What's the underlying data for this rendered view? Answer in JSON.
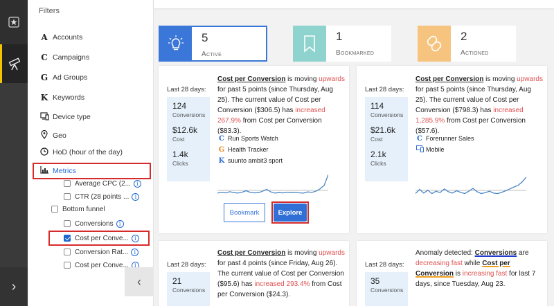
{
  "filters": {
    "title": "Filters",
    "items": [
      {
        "icon": "A",
        "label": "Accounts"
      },
      {
        "icon": "C",
        "label": "Campaigns"
      },
      {
        "icon": "G",
        "label": "Ad Groups"
      },
      {
        "icon": "K",
        "label": "Keywords"
      },
      {
        "icon": "device-icon",
        "label": "Device type"
      },
      {
        "icon": "location-pin-icon",
        "label": "Geo"
      },
      {
        "icon": "clock-icon",
        "label": "HoD (hour of the day)"
      },
      {
        "icon": "bar-chart-icon",
        "label": "Metrics"
      }
    ],
    "sub": {
      "avg_cpc": "Average CPC (2...",
      "ctr": "CTR (28 points ...",
      "bottom_funnel": "Bottom funnel",
      "conversions": "Conversions",
      "cost_per_conv": "Cost per Conve...",
      "conv_rate": "Conversion Rat...",
      "cost_per_conv2": "Cost per Conve..."
    }
  },
  "tiles": [
    {
      "count": "5",
      "label": "Active",
      "color": "#3a77d8"
    },
    {
      "count": "1",
      "label": "Bookmarked",
      "color": "#8fd3cf"
    },
    {
      "count": "2",
      "label": "Actioned",
      "color": "#f6c47f"
    }
  ],
  "cards": [
    {
      "last": "Last 28 days:",
      "stats": [
        {
          "v": "124",
          "k": "Conversions"
        },
        {
          "v": "$12.6k",
          "k": "Cost"
        },
        {
          "v": "1.4k",
          "k": "Clicks"
        }
      ],
      "metric": "Cost per Conversion",
      "t1": " is moving ",
      "dir": "upwards",
      "t2": " for past 5 points (since Thursday, Aug 25). The current value of Cost per Conversion ($306.5) has ",
      "change": "increased 267.9%",
      "t3": " from Cost per Conversion ($83.3).",
      "sources": [
        {
          "icon": "C",
          "label": "Run Sports Watch"
        },
        {
          "icon": "G",
          "label": "Health Tracker"
        },
        {
          "icon": "K",
          "label": "suunto ambit3 sport"
        }
      ],
      "bookmark": "Bookmark",
      "explore": "Explore"
    },
    {
      "last": "Last 28 days:",
      "stats": [
        {
          "v": "114",
          "k": "Conversions"
        },
        {
          "v": "$21.6k",
          "k": "Cost"
        },
        {
          "v": "2.1k",
          "k": "Clicks"
        }
      ],
      "metric": "Cost per Conversion",
      "t1": " is moving ",
      "dir": "upwards",
      "t2": " for past 5 points (since Thursday, Aug 25). The current value of Cost per Conversion ($798.3) has ",
      "change": "increased 1,285.9%",
      "t3": " from Cost per Conversion ($57.6).",
      "sources": [
        {
          "icon": "C",
          "label": "Forerunner Sales"
        },
        {
          "icon": "device-icon",
          "label": "Mobile"
        }
      ]
    },
    {
      "last": "Last 28 days:",
      "stats": [
        {
          "v": "21",
          "k": "Conversions"
        }
      ],
      "metric": "Cost per Conversion",
      "t1": " is moving ",
      "dir": "upwards",
      "t2": " for past 4 points (since Friday, Aug 26). The current value of Cost per Conversion ($95.6) has ",
      "change": "increased 293.4%",
      "t3": " from Cost per Conversion ($24.3)."
    },
    {
      "last": "Last 28 days:",
      "stats": [
        {
          "v": "35",
          "k": "Conversions"
        }
      ],
      "a1": "Anomaly detected: ",
      "a_metric1": "Conversions",
      "a2": " are ",
      "a_dir1": "decreasing fast",
      "a3": " while ",
      "a_metric2": "Cost per Conversion",
      "a4": " is ",
      "a_dir2": "increasing fast",
      "a5": " for last 7 days, since Tuesday, Aug 23."
    }
  ],
  "sparklines": {
    "card1": [
      0.12,
      0.15,
      0.13,
      0.18,
      0.14,
      0.12,
      0.16,
      0.22,
      0.15,
      0.13,
      0.14,
      0.2,
      0.28,
      0.17,
      0.12,
      0.14,
      0.13,
      0.16,
      0.14,
      0.15,
      0.13,
      0.12,
      0.17,
      0.15,
      0.2,
      0.3,
      0.45,
      0.9
    ],
    "card2": [
      0.1,
      0.28,
      0.12,
      0.24,
      0.1,
      0.2,
      0.14,
      0.3,
      0.18,
      0.12,
      0.22,
      0.15,
      0.1,
      0.2,
      0.32,
      0.18,
      0.1,
      0.14,
      0.2,
      0.12,
      0.1,
      0.15,
      0.22,
      0.3,
      0.38,
      0.45,
      0.6,
      0.8
    ]
  }
}
